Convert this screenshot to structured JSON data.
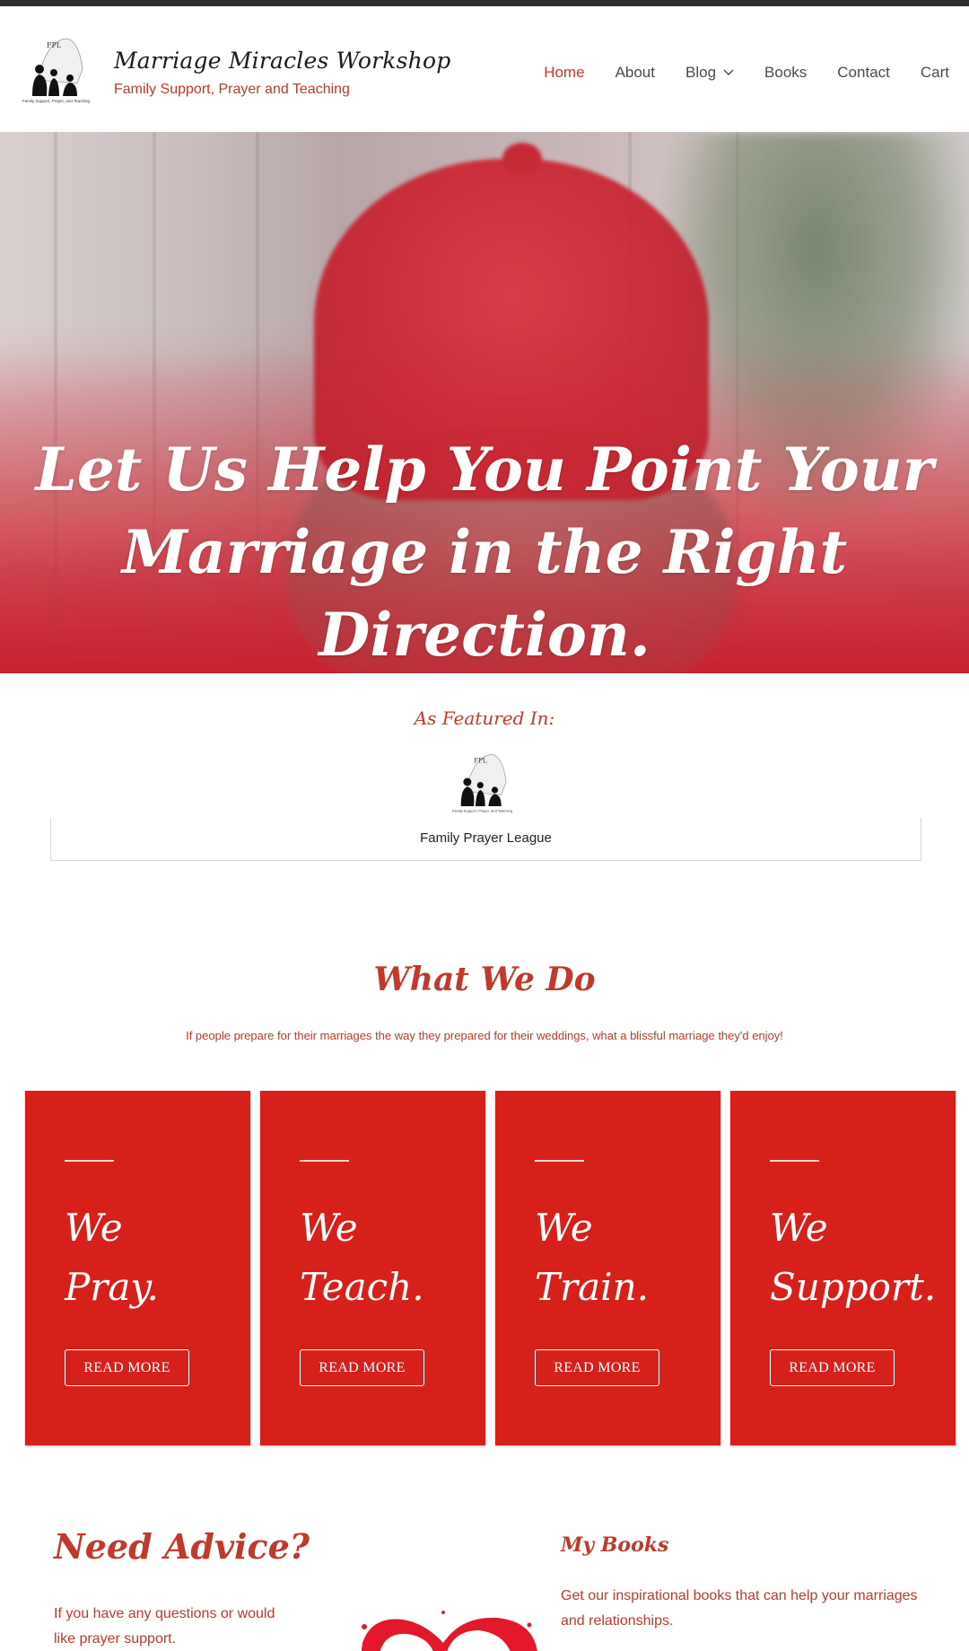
{
  "site": {
    "title": "Marriage Miracles Workshop",
    "tagline": "Family Support, Prayer and Teaching",
    "logo_icon": "family-prayer-league-logo",
    "logo_text": "Family Support, Prayer, and Teaching"
  },
  "nav": {
    "items": [
      {
        "label": "Home",
        "active": true
      },
      {
        "label": "About",
        "active": false
      },
      {
        "label": "Blog",
        "active": false,
        "has_dropdown": true
      },
      {
        "label": "Books",
        "active": false
      },
      {
        "label": "Contact",
        "active": false
      },
      {
        "label": "Cart",
        "active": false
      }
    ]
  },
  "hero": {
    "heading_line1": "Let Us Help You Point Your",
    "heading_line2": "Marriage in the Right Direction."
  },
  "featured": {
    "title": "As Featured In:",
    "logo_icon": "family-prayer-league-logo",
    "caption": "Family Prayer League"
  },
  "what_we_do": {
    "title": "What We Do",
    "subtitle": "If people prepare for their marriages the way they prepared for their weddings, what a blissful marriage they'd enjoy!",
    "cards": [
      {
        "line1": "We",
        "line2": "Pray.",
        "button": "READ MORE"
      },
      {
        "line1": "We",
        "line2": "Teach.",
        "button": "READ MORE"
      },
      {
        "line1": "We",
        "line2": "Train.",
        "button": "READ MORE"
      },
      {
        "line1": "We",
        "line2": "Support.",
        "button": "READ MORE"
      }
    ]
  },
  "advice": {
    "title": "Need Advice?",
    "text": "If you have any questions or would like prayer support."
  },
  "books": {
    "title": "My Books",
    "text": "Get our inspirational books that can help your marriages and relationships."
  },
  "colors": {
    "accent": "#c0392b",
    "card_red": "#d8201b",
    "topbar": "#2d2d31"
  }
}
